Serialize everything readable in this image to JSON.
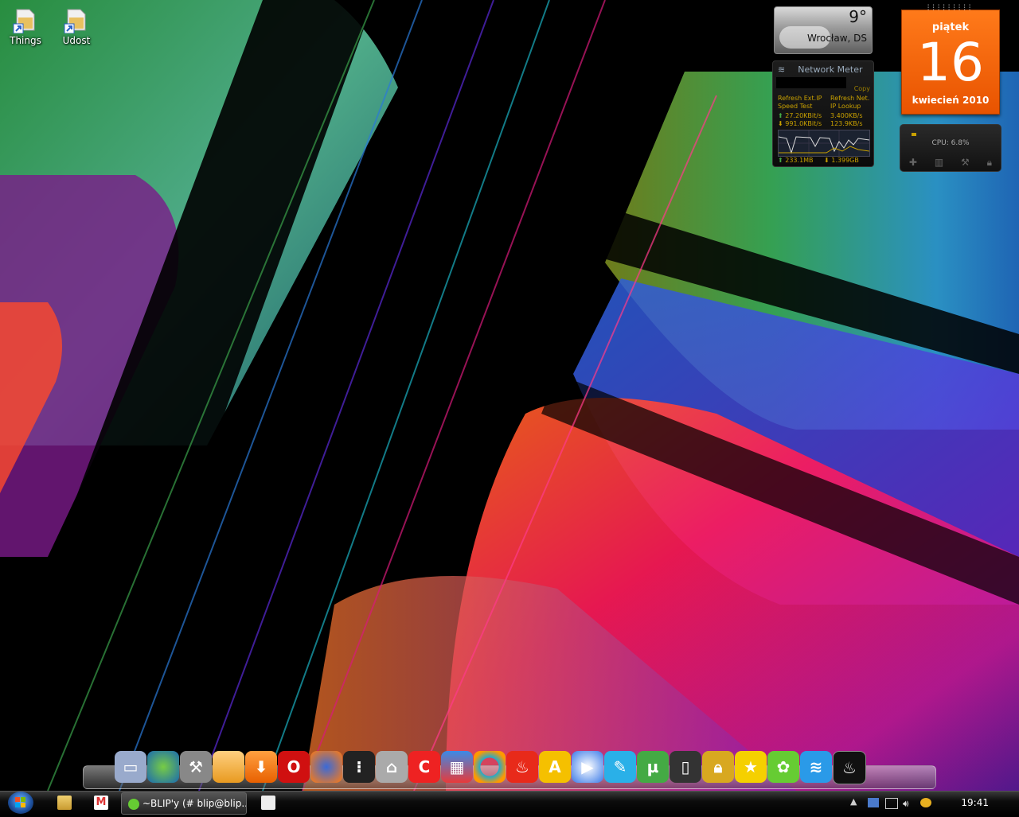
{
  "desktop": {
    "icons": [
      {
        "label": "Things"
      },
      {
        "label": "Udost"
      }
    ]
  },
  "weather": {
    "temp": "9°",
    "city": "Wrocław, DS"
  },
  "network_meter": {
    "title": "Network Meter",
    "copy": "Copy",
    "refresh_ext": "Refresh Ext.IP",
    "refresh_net": "Refresh Net.",
    "speed_test": "Speed Test",
    "ip_lookup": "IP Lookup",
    "up_rate": "27.20KBit/s",
    "up_rate2": "3.400KB/s",
    "down_rate": "991.0KBit/s",
    "down_rate2": "123.9KB/s",
    "total_up": "233.1MB",
    "total_down": "1.399GB"
  },
  "calendar": {
    "weekday": "piątek",
    "day": "16",
    "month_year": "kwiecień 2010"
  },
  "cpu": {
    "label": "CPU: 6.8%"
  },
  "dock": {
    "items": [
      "computer-icon",
      "globe-icon",
      "tools-icon",
      "folder-icon",
      "downloads-icon",
      "opera-icon",
      "firefox-icon",
      "antenna-icon",
      "trash-icon",
      "ccleaner-icon",
      "cubes-icon",
      "sync-icon",
      "burn-icon",
      "aimp-icon",
      "media-player-icon",
      "feather-icon",
      "utorrent-icon",
      "ipod-icon",
      "lock-icon",
      "star-icon",
      "gadu-icon",
      "waves-icon",
      "steam-icon"
    ]
  },
  "taskbar": {
    "task_title": "~BLIP'y (# blip@blip....",
    "clock": "19:41"
  },
  "colors": {
    "calendar": "#f06510",
    "taskbar": "#000000"
  }
}
